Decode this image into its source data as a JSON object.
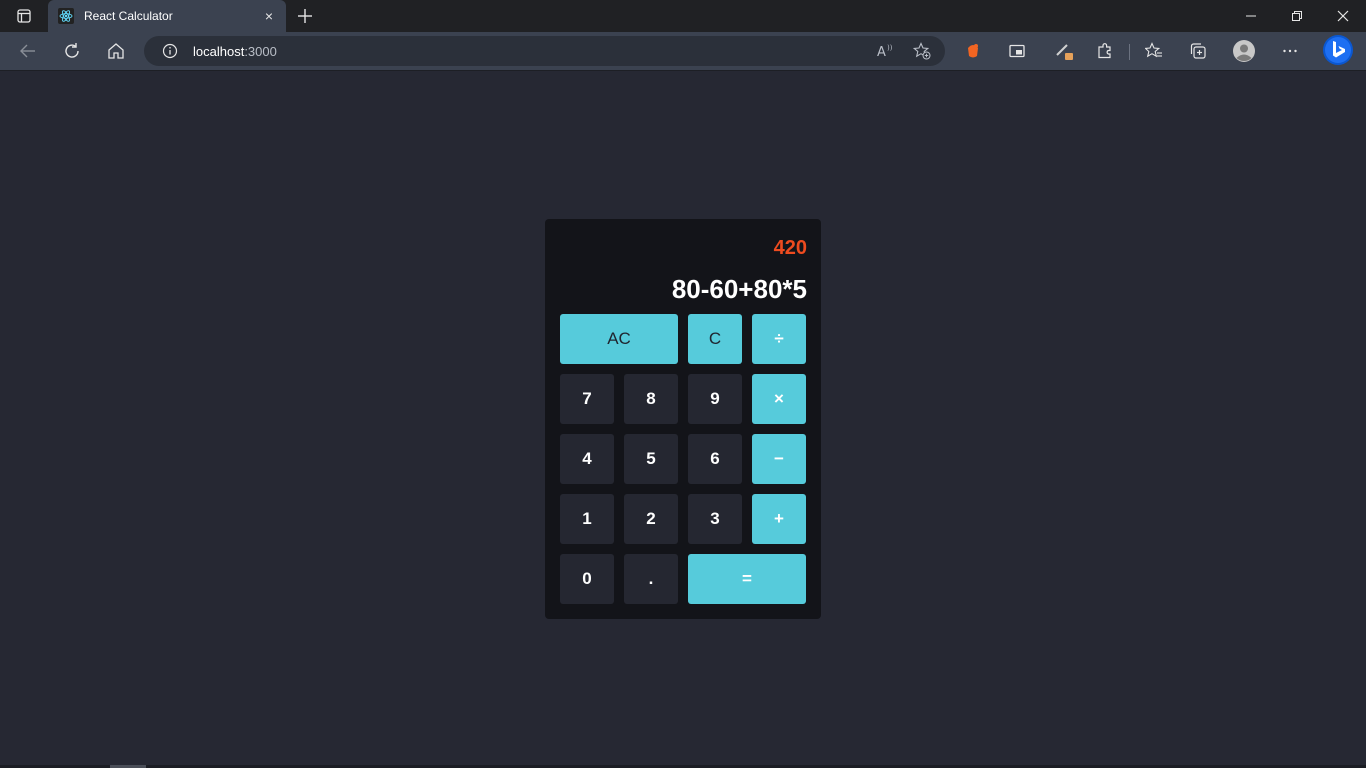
{
  "browser": {
    "tab_title": "React Calculator",
    "tab_close": "×",
    "url_host": "localhost",
    "url_port": ":3000"
  },
  "calculator": {
    "result": "420",
    "expression": "80-60+80*5",
    "keys": {
      "ac": "AC",
      "c": "C",
      "divide": "÷",
      "seven": "7",
      "eight": "8",
      "nine": "9",
      "multiply": "×",
      "four": "4",
      "five": "5",
      "six": "6",
      "minus": "−",
      "one": "1",
      "two": "2",
      "three": "3",
      "plus": "+",
      "zero": "0",
      "dot": ".",
      "equals": "="
    }
  },
  "colors": {
    "page_bg": "#262833",
    "calc_bg": "#131419",
    "accent": "#56cbdb",
    "result": "#ee4b1f",
    "number_key": "#252731"
  }
}
